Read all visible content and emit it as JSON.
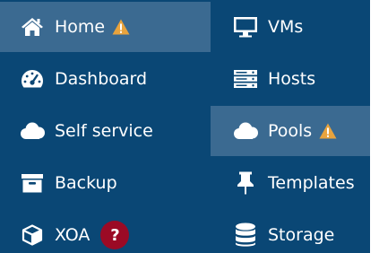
{
  "colors": {
    "menu_bg": "#0a4775",
    "active_bg": "#3b6a91",
    "text": "#ffffff",
    "warning": "#e8a33d",
    "help_badge": "#9b0a25"
  },
  "left_menu": {
    "items": [
      {
        "label": "Home",
        "icon": "home-icon",
        "active": true,
        "badge": "warning-icon"
      },
      {
        "label": "Dashboard",
        "icon": "dashboard-icon"
      },
      {
        "label": "Self service",
        "icon": "cloud-icon"
      },
      {
        "label": "Backup",
        "icon": "archive-icon"
      },
      {
        "label": "XOA",
        "icon": "cube-icon",
        "badge_text": "?"
      }
    ]
  },
  "right_menu": {
    "items": [
      {
        "label": "VMs",
        "icon": "desktop-icon"
      },
      {
        "label": "Hosts",
        "icon": "server-icon"
      },
      {
        "label": "Pools",
        "icon": "cloud-icon",
        "active": true,
        "badge": "warning-icon"
      },
      {
        "label": "Templates",
        "icon": "thumbtack-icon"
      },
      {
        "label": "Storage",
        "icon": "database-icon"
      }
    ]
  }
}
